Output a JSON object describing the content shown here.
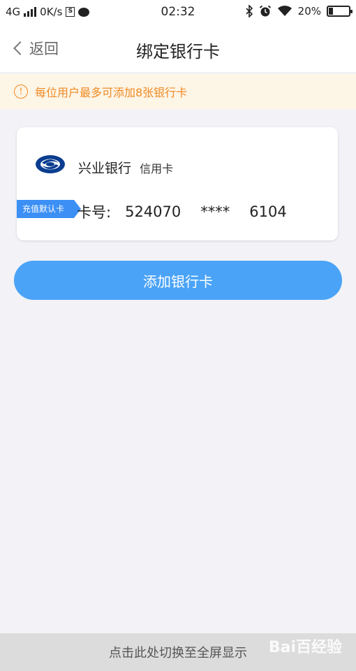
{
  "status_bar": {
    "network": "4G",
    "speed": "0K/s",
    "time": "02:32",
    "battery": "20%",
    "icons": [
      "signal-icon",
      "storage-icon",
      "message-icon",
      "bluetooth-icon",
      "alarm-icon",
      "wifi-icon",
      "battery-icon"
    ]
  },
  "nav": {
    "back_label": "返回",
    "title": "绑定银行卡"
  },
  "notice": {
    "icon": "!",
    "text": "每位用户最多可添加8张银行卡",
    "color": "#f08a24"
  },
  "card": {
    "bank_name": "兴业银行",
    "card_type": "信用卡",
    "default_tag": "充值默认卡",
    "number_label": "卡号:",
    "number_first": "524070",
    "number_mask": "****",
    "number_last": "6104",
    "tag_color": "#3b8ff5"
  },
  "add_button": {
    "label": "添加银行卡",
    "color": "#4aa3f7"
  },
  "bottom_bar": {
    "label": "点击此处切换至全屏显示"
  },
  "watermark": {
    "text": "Bai百经验"
  }
}
